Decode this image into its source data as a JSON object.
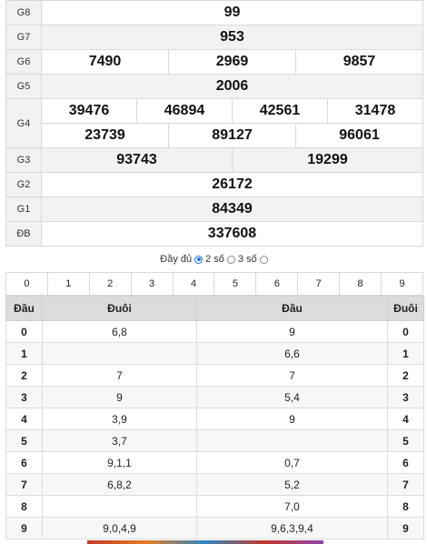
{
  "prizes": [
    {
      "label": "G8",
      "values": [
        "99"
      ],
      "highlight": true
    },
    {
      "label": "G7",
      "values": [
        "953"
      ]
    },
    {
      "label": "G6",
      "values": [
        "7490",
        "2969",
        "9857"
      ]
    },
    {
      "label": "G5",
      "values": [
        "2006"
      ]
    },
    {
      "label": "G4",
      "rows": [
        [
          "39476",
          "46894",
          "42561",
          "31478"
        ],
        [
          "23739",
          "89127",
          "96061"
        ]
      ]
    },
    {
      "label": "G3",
      "values": [
        "93743",
        "19299"
      ]
    },
    {
      "label": "G2",
      "values": [
        "26172"
      ]
    },
    {
      "label": "G1",
      "values": [
        "84349"
      ]
    },
    {
      "label": "ĐB",
      "values": [
        "337608"
      ],
      "highlight": true
    }
  ],
  "filter": {
    "option_full": "Đầy đủ",
    "option_two": "2 số",
    "option_three": "3 số",
    "selected": "option_full"
  },
  "digits": [
    "0",
    "1",
    "2",
    "3",
    "4",
    "5",
    "6",
    "7",
    "8",
    "9"
  ],
  "loto": {
    "headers": [
      "Đầu",
      "Đuôi",
      "Đầu",
      "Đuôi"
    ],
    "rows": [
      {
        "d1": "0",
        "tail": "6,8",
        "head": "9",
        "d2": "0"
      },
      {
        "d1": "1",
        "tail": "",
        "head": "6,6",
        "d2": "1"
      },
      {
        "d1": "2",
        "tail": "7",
        "head": "7",
        "d2": "2"
      },
      {
        "d1": "3",
        "tail": "9",
        "head": "5,4",
        "d2": "3"
      },
      {
        "d1": "4",
        "tail": "3,9",
        "head": "9",
        "d2": "4"
      },
      {
        "d1": "5",
        "tail": "3,7",
        "head": "",
        "d2": "5"
      },
      {
        "d1": "6",
        "tail": "9,1,1",
        "head": "0,7",
        "d2": "6"
      },
      {
        "d1": "7",
        "tail": "6,8,2",
        "head": "5,2",
        "d2": "7"
      },
      {
        "d1": "8",
        "tail": "",
        "head": "7,0",
        "d2": "8"
      },
      {
        "d1": "9",
        "tail": "9,0,4,9",
        "head": "9,6,3,9,4",
        "d2": "9"
      }
    ]
  },
  "colors": {
    "highlight": "#d0021b",
    "header_bg": "#dcdcdc",
    "label_bg": "#f2f2f2"
  }
}
